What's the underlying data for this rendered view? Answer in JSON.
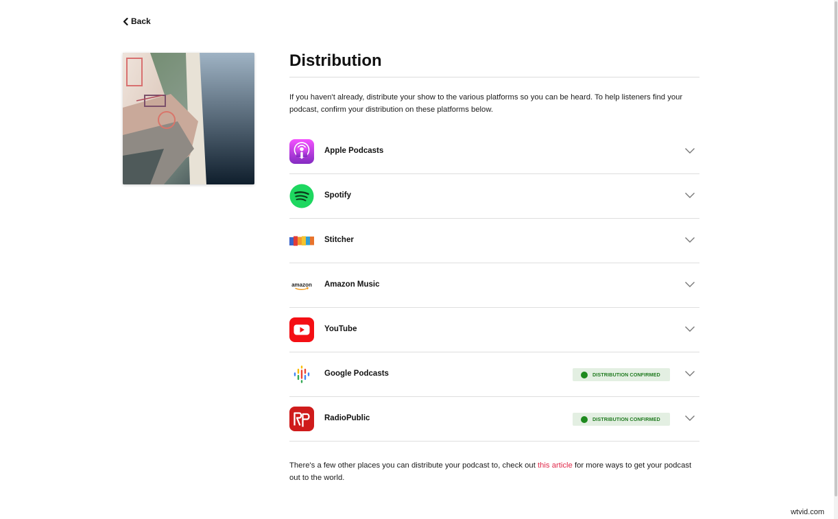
{
  "nav": {
    "back_label": "Back"
  },
  "page": {
    "title": "Distribution",
    "intro": "If you haven't already, distribute your show to the various platforms so you can be heard. To help listeners find your podcast, confirm your distribution on these platforms below."
  },
  "platforms": [
    {
      "name": "Apple Podcasts",
      "icon": "apple-podcasts-logo",
      "status": ""
    },
    {
      "name": "Spotify",
      "icon": "spotify-logo",
      "status": ""
    },
    {
      "name": "Stitcher",
      "icon": "stitcher-logo",
      "status": ""
    },
    {
      "name": "Amazon Music",
      "icon": "amazon-music-logo",
      "status": ""
    },
    {
      "name": "YouTube",
      "icon": "youtube-logo",
      "status": ""
    },
    {
      "name": "Google Podcasts",
      "icon": "google-podcasts-logo",
      "status": "DISTRIBUTION CONFIRMED"
    },
    {
      "name": "RadioPublic",
      "icon": "radiopublic-logo",
      "status": "DISTRIBUTION CONFIRMED"
    }
  ],
  "footer": {
    "before": "There's a few other places you can distribute your podcast to, check out ",
    "link": "this article",
    "after": " for more ways to get your podcast out to the world."
  },
  "logo_text": {
    "amazon": "amazon"
  },
  "watermark": "wtvid.com",
  "colors": {
    "link": "#e0294a",
    "confirmed_bg": "#e3efe2",
    "confirmed_dot": "#1e8a1e"
  }
}
